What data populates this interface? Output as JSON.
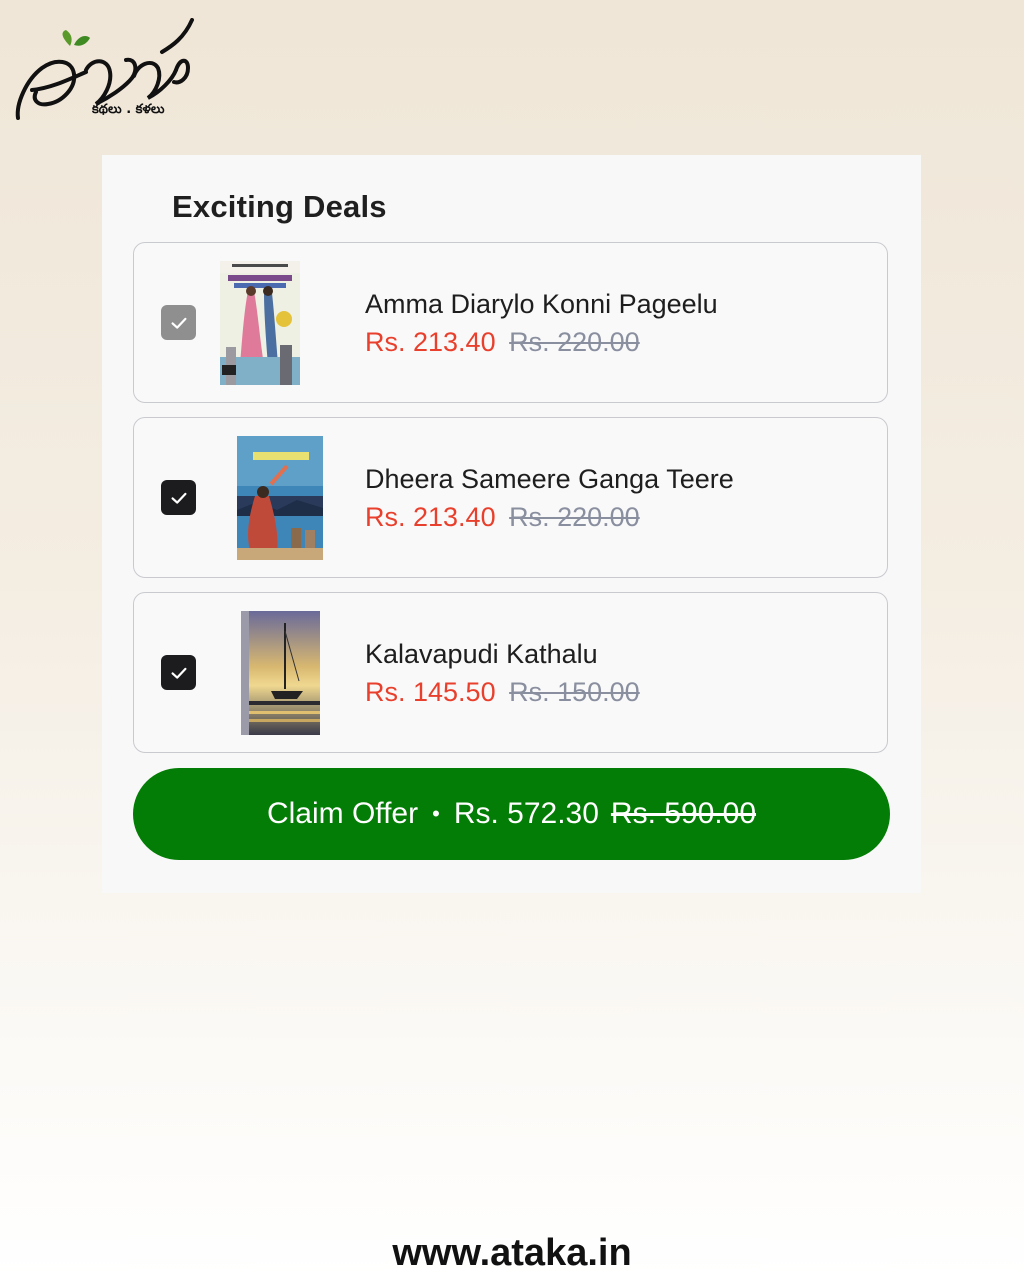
{
  "brand": {
    "logo_text": "అటక",
    "tagline": "కథలు . కళలు"
  },
  "deals": {
    "title": "Exciting Deals",
    "items": [
      {
        "title": "Amma Diarylo Konni Pageelu",
        "price": "Rs. 213.40",
        "original_price": "Rs. 220.00",
        "checked": true,
        "locked": true
      },
      {
        "title": "Dheera Sameere Ganga Teere",
        "price": "Rs. 213.40",
        "original_price": "Rs. 220.00",
        "checked": true,
        "locked": false
      },
      {
        "title": "Kalavapudi Kathalu",
        "price": "Rs. 145.50",
        "original_price": "Rs. 150.00",
        "checked": true,
        "locked": false
      }
    ]
  },
  "claim": {
    "label": "Claim Offer",
    "separator": "•",
    "total": "Rs. 572.30",
    "original_total": "Rs. 590.00"
  },
  "footer": {
    "url": "www.ataka.in"
  },
  "colors": {
    "sale_price": "#e8402c",
    "original_price": "#8a8fa0",
    "claim_button": "#037d05",
    "checkbox": "#1c1c1e"
  }
}
